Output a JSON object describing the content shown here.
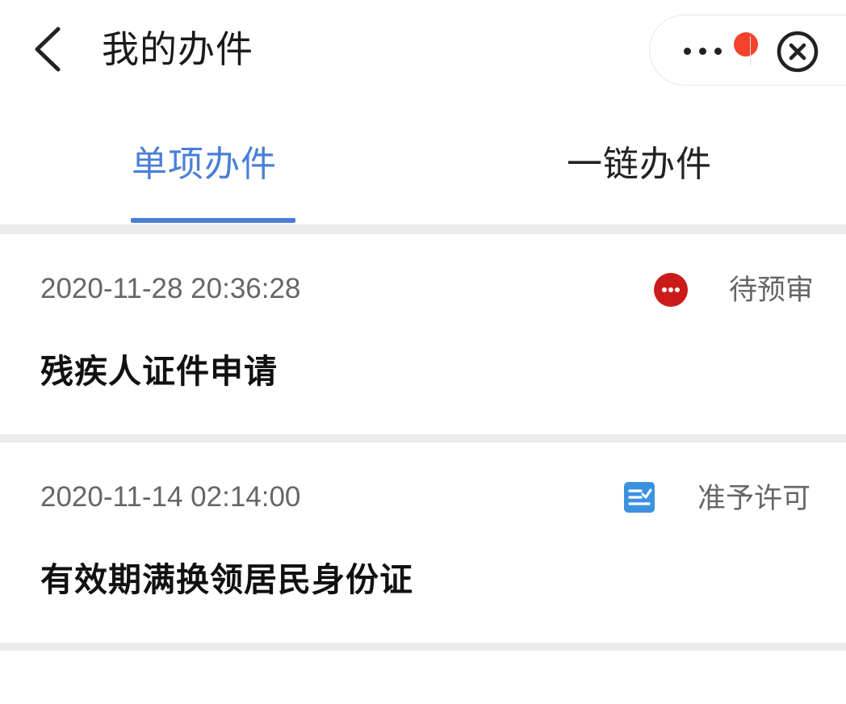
{
  "header": {
    "title": "我的办件"
  },
  "tabs": [
    {
      "label": "单项办件",
      "active": true
    },
    {
      "label": "一链办件",
      "active": false
    }
  ],
  "records": [
    {
      "time": "2020-11-28 20:36:28",
      "status": "待预审",
      "status_icon": "more-circle-icon",
      "status_icon_color": "#cc1b1b",
      "title": "残疾人证件申请"
    },
    {
      "time": "2020-11-14 02:14:00",
      "status": "准予许可",
      "status_icon": "document-check-icon",
      "status_icon_color": "#3a92e0",
      "title": "有效期满换领居民身份证"
    }
  ],
  "colors": {
    "accent": "#4a7fd6",
    "badge": "#f5422c",
    "separator": "#ececec"
  }
}
